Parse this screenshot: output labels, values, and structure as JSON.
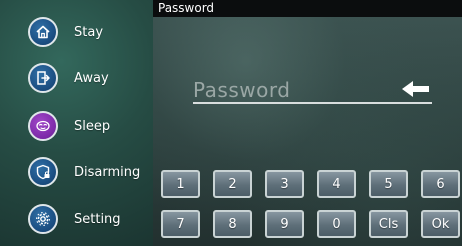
{
  "sidebar": {
    "items": [
      {
        "label": "Stay",
        "icon": "home-icon"
      },
      {
        "label": "Away",
        "icon": "exit-door-icon"
      },
      {
        "label": "Sleep",
        "icon": "sleep-icon"
      },
      {
        "label": "Disarming",
        "icon": "shield-unlock-icon"
      },
      {
        "label": "Setting",
        "icon": "gear-icon"
      }
    ]
  },
  "panel": {
    "title": "Password",
    "password": {
      "placeholder": "Password",
      "value": ""
    },
    "backspace_icon": "backspace-arrow-icon"
  },
  "keypad": {
    "row1": [
      "1",
      "2",
      "3",
      "4",
      "5",
      "6"
    ],
    "row2": [
      "7",
      "8",
      "9",
      "0",
      "Cls",
      "Ok"
    ]
  },
  "colors": {
    "sidebar_bg": "#264c44",
    "icon_blue": "#1b4e82",
    "icon_purple": "#7c2aa8",
    "title_bar": "#0b0d0e",
    "key_face": "#5e6f79"
  }
}
